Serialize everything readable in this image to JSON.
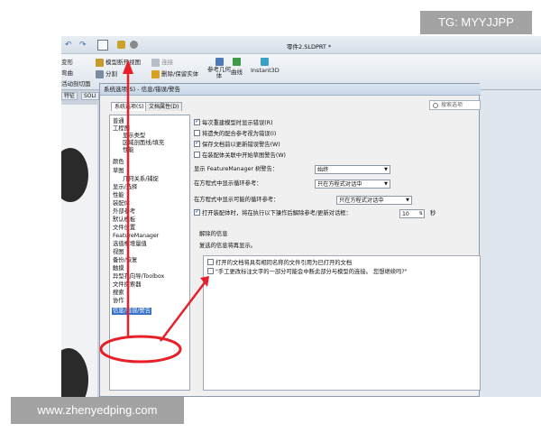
{
  "app": {
    "document_title": "零件2.SLDPRT *",
    "ribbon": {
      "model_break_view": "模型断开视图",
      "connect": "连接",
      "split": "分割",
      "delete_keep_body": "删除/保留实体",
      "reference_geometry": "参考几何体",
      "curve": "曲线",
      "instant3d": "Instant3D",
      "left_clipped_1": "变形",
      "left_clipped_2": "弯曲",
      "left_clipped_3": "活动剖切面"
    },
    "left_tabs": [
      "特征",
      "SOLI"
    ]
  },
  "dialog": {
    "title": "系统选项(S) - 信息/错误/警告",
    "tabs": [
      "系统选项(S)",
      "文档属性(D)"
    ],
    "search_placeholder": "搜索选项",
    "tree": [
      "普通",
      "工程图",
      "显示类型",
      "区域剖面线/填充",
      "性能",
      "颜色",
      "草图",
      "几何关系/捕捉",
      "显示/选择",
      "性能",
      "装配体",
      "外部参考",
      "默认模板",
      "文件位置",
      "FeatureManager",
      "选值框增量值",
      "视图",
      "备份/恢复",
      "触摸",
      "异型孔向导/Toolbox",
      "文件探索器",
      "搜索",
      "协作",
      "信息/错误/警告"
    ],
    "options": {
      "cb1": "每次重建模型时显示错误(R)",
      "cb2": "将遗失的配合参考视为错误(I)",
      "cb3": "保存文档前以更新错误警告(W)",
      "cb4": "在装配体关联中开始草图警告(W)",
      "fm_warning_label": "显示 FeatureManager 树警告：",
      "fm_warning_value": "始终",
      "circ_ref_label": "在方程式中显示循环参考：",
      "circ_ref_value": "只在方程式对话中",
      "possible_circ_label": "在方程式中显示可能的循环参考：",
      "possible_circ_value": "只在方程式对话中",
      "dismiss_label": "打开装配体时，将在执行以下操作后解除参考/更新对话框：",
      "dismiss_value": "10",
      "dismiss_unit": "秒",
      "dismissed_group": "解除的信息",
      "dismissed_hint": "复选的信息将再显示。",
      "dismissed_items": [
        "打开的文档将具有相同名称的文件引用为已打开的文档",
        "\"手工更改标注文字的一部分可能会中断此部分与模型的连接。 您想继续吗?\""
      ]
    },
    "checks": {
      "cb1": true,
      "cb2": false,
      "cb3": true,
      "cb4": false
    }
  },
  "watermarks": {
    "top_right": "TG: MYYJJPP",
    "bottom_left": "www.zhenyedping.com"
  },
  "colors": {
    "annotation": "#e8202a",
    "selection": "#3a73c7"
  }
}
